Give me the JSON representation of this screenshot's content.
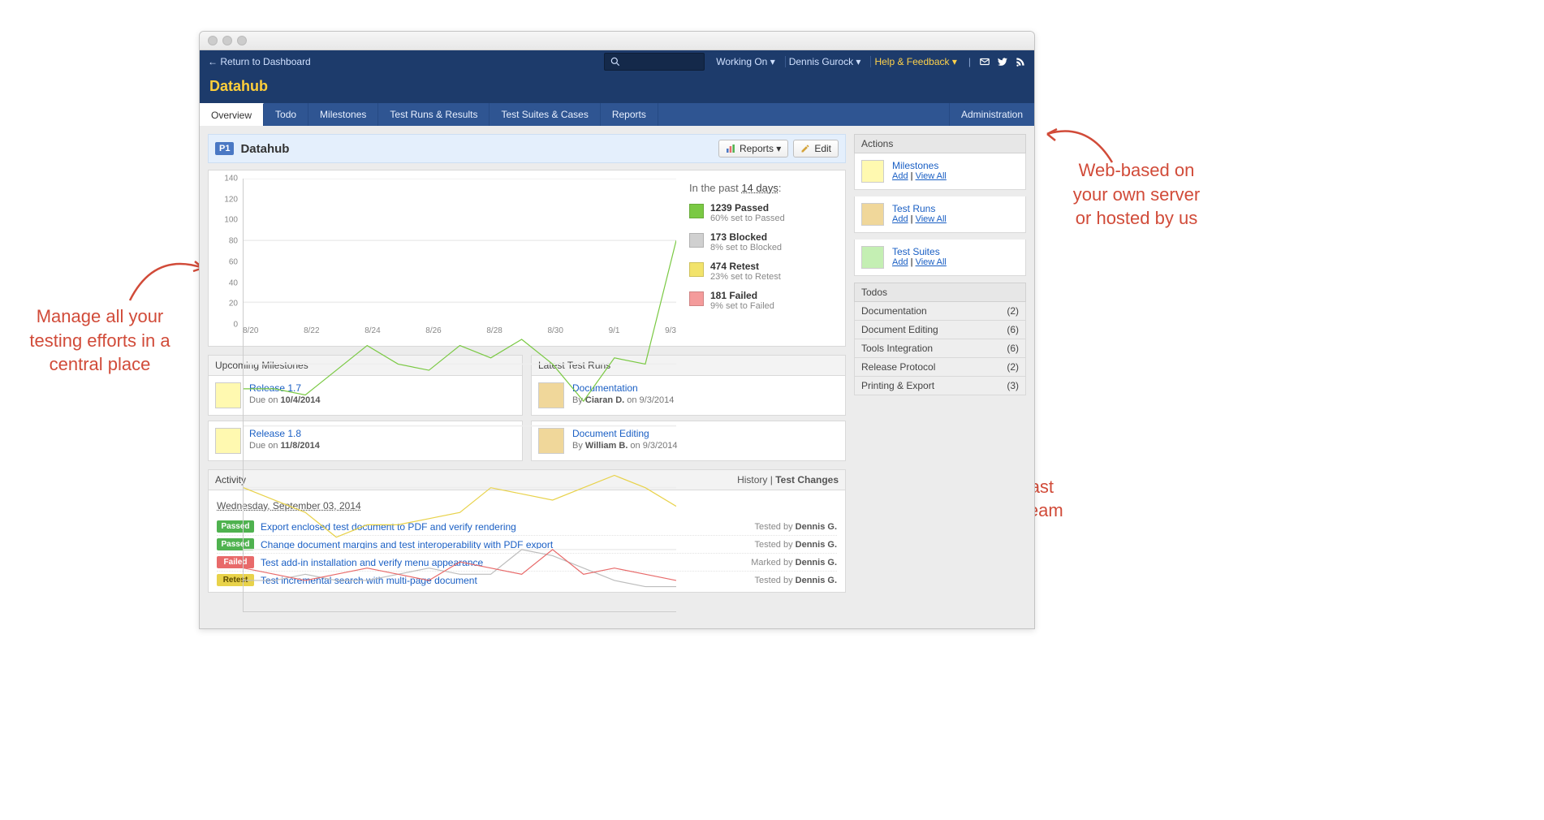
{
  "banner": {
    "return_label": "← Return to Dashboard",
    "search_placeholder": "",
    "working_on_label": "Working On ▾",
    "user_label": "Dennis Gurock ▾",
    "help_label": "Help & Feedback ▾",
    "app_name": "Datahub"
  },
  "tabs": {
    "items": [
      "Overview",
      "Todo",
      "Milestones",
      "Test Runs & Results",
      "Test Suites & Cases",
      "Reports"
    ],
    "admin": "Administration",
    "active": 0
  },
  "page": {
    "priority": "P1",
    "title": "Datahub",
    "reports_btn": "Reports ▾",
    "edit_btn": "Edit"
  },
  "chart_data": {
    "type": "line",
    "title": "",
    "xlabel": "",
    "ylabel": "",
    "ylim": [
      0,
      140
    ],
    "y_ticks": [
      0,
      20,
      40,
      60,
      80,
      100,
      120,
      140
    ],
    "categories": [
      "8/20",
      "8/21",
      "8/22",
      "8/23",
      "8/24",
      "8/25",
      "8/26",
      "8/27",
      "8/28",
      "8/29",
      "8/30",
      "8/31",
      "9/1",
      "9/2",
      "9/3"
    ],
    "x_ticks_shown": [
      "8/20",
      "8/22",
      "8/24",
      "8/26",
      "8/28",
      "8/30",
      "9/1",
      "9/3"
    ],
    "series": [
      {
        "name": "Passed",
        "color": "#7ac943",
        "values": [
          72,
          72,
          70,
          78,
          86,
          80,
          78,
          86,
          82,
          88,
          80,
          68,
          82,
          80,
          120
        ]
      },
      {
        "name": "Retest",
        "color": "#e8d24a",
        "values": [
          40,
          36,
          32,
          24,
          28,
          28,
          30,
          32,
          40,
          38,
          36,
          40,
          44,
          40,
          34
        ]
      },
      {
        "name": "Blocked",
        "color": "#bdbdbd",
        "values": [
          10,
          10,
          12,
          10,
          10,
          12,
          14,
          12,
          12,
          20,
          18,
          14,
          10,
          8,
          8
        ]
      },
      {
        "name": "Failed",
        "color": "#e86a6a",
        "values": [
          14,
          12,
          10,
          12,
          14,
          12,
          10,
          16,
          14,
          12,
          20,
          12,
          14,
          12,
          10
        ]
      }
    ]
  },
  "legend": {
    "title_prefix": "In the past ",
    "title_days": "14 days",
    "title_suffix": ":",
    "items": [
      {
        "color": "#7ac943",
        "count": "1239",
        "label": "Passed",
        "sub": "60% set to Passed"
      },
      {
        "color": "#d0d0d0",
        "count": "173",
        "label": "Blocked",
        "sub": "8% set to Blocked"
      },
      {
        "color": "#f2e36b",
        "count": "474",
        "label": "Retest",
        "sub": "23% set to Retest"
      },
      {
        "color": "#f49b9b",
        "count": "181",
        "label": "Failed",
        "sub": "9% set to Failed"
      }
    ]
  },
  "upcoming": {
    "heading": "Upcoming Milestones",
    "items": [
      {
        "color": "yellow",
        "title": "Release 1.7",
        "sub_pre": "Due on ",
        "sub_bold": "10/4/2014"
      },
      {
        "color": "yellow",
        "title": "Release 1.8",
        "sub_pre": "Due on ",
        "sub_bold": "11/8/2014"
      }
    ]
  },
  "latest": {
    "heading": "Latest Test Runs",
    "items": [
      {
        "color": "tan",
        "title": "Documentation",
        "sub_pre": "By ",
        "sub_bold": "Ciaran D.",
        "sub_post": " on 9/3/2014"
      },
      {
        "color": "tan",
        "title": "Document Editing",
        "sub_pre": "By ",
        "sub_bold": "William B.",
        "sub_post": " on 9/3/2014"
      }
    ]
  },
  "activity": {
    "heading": "Activity",
    "history_label": "History",
    "changes_label": "Test Changes",
    "date": "Wednesday, September 03, 2014",
    "rows": [
      {
        "status": "Passed",
        "cls": "passed",
        "title": "Export enclosed test document to PDF and verify rendering",
        "verb": "Tested by",
        "who": "Dennis G."
      },
      {
        "status": "Passed",
        "cls": "passed",
        "title": "Change document margins and test interoperability with PDF export",
        "verb": "Tested by",
        "who": "Dennis G."
      },
      {
        "status": "Failed",
        "cls": "failed",
        "title": "Test add-in installation and verify menu appearance",
        "verb": "Marked by",
        "who": "Dennis G."
      },
      {
        "status": "Retest",
        "cls": "retest",
        "title": "Test incremental search with multi-page document",
        "verb": "Tested by",
        "who": "Dennis G."
      }
    ]
  },
  "sidebar": {
    "actions_heading": "Actions",
    "actions": [
      {
        "color": "yellow",
        "title": "Milestones",
        "link1": "Add",
        "link2": "View All"
      },
      {
        "color": "tan",
        "title": "Test Runs",
        "link1": "Add",
        "link2": "View All"
      },
      {
        "color": "green",
        "title": "Test Suites",
        "link1": "Add",
        "link2": "View All"
      }
    ],
    "todos_heading": "Todos",
    "todos": [
      {
        "label": "Documentation",
        "count": "(2)"
      },
      {
        "label": "Document Editing",
        "count": "(6)"
      },
      {
        "label": "Tools Integration",
        "count": "(6)"
      },
      {
        "label": "Release Protocol",
        "count": "(2)"
      },
      {
        "label": "Printing & Export",
        "count": "(3)"
      }
    ]
  },
  "annotations": {
    "left": "Manage all your\ntesting efforts in a\ncentral place",
    "right_top": "Web-based on\nyour own server\nor hosted by us",
    "right_bottom": "Modern user\ninterface for a fast\nand productive team"
  }
}
